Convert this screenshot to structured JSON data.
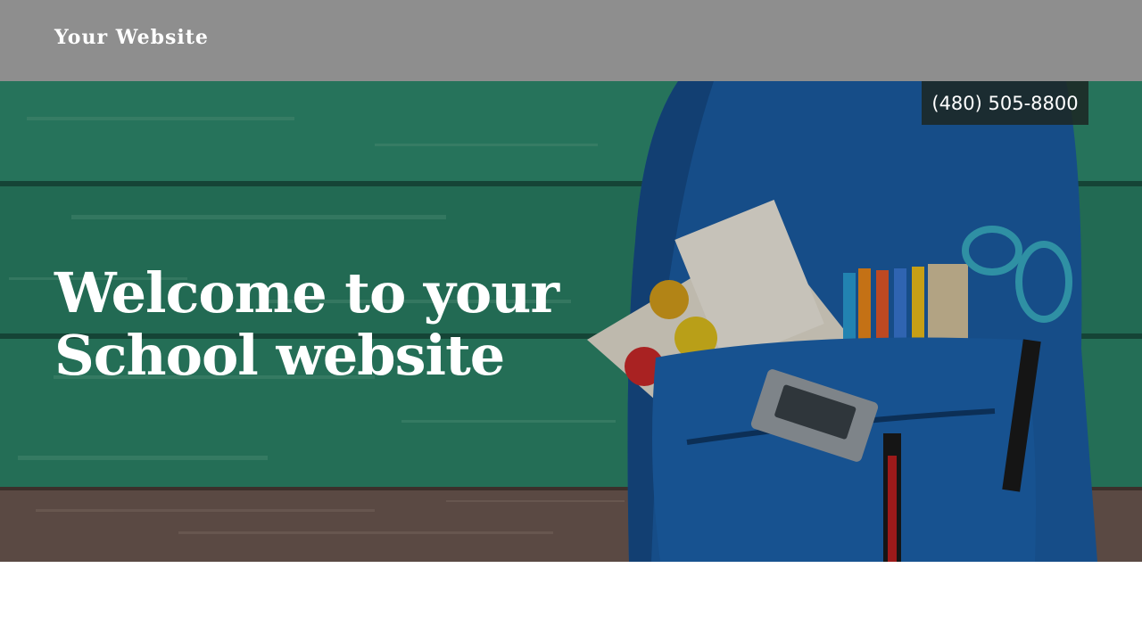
{
  "header": {
    "site_title": "Your Website"
  },
  "hero": {
    "phone": "(480) 505-8800",
    "title": "Welcome to your School website",
    "image_description_icon": "backpack-school-supplies-image"
  },
  "colors": {
    "header_bg": "#8e8e8e",
    "wood_green": "#2e8a6c",
    "backpack_blue": "#1a5aa0",
    "phone_badge_bg": "#1c2824"
  }
}
